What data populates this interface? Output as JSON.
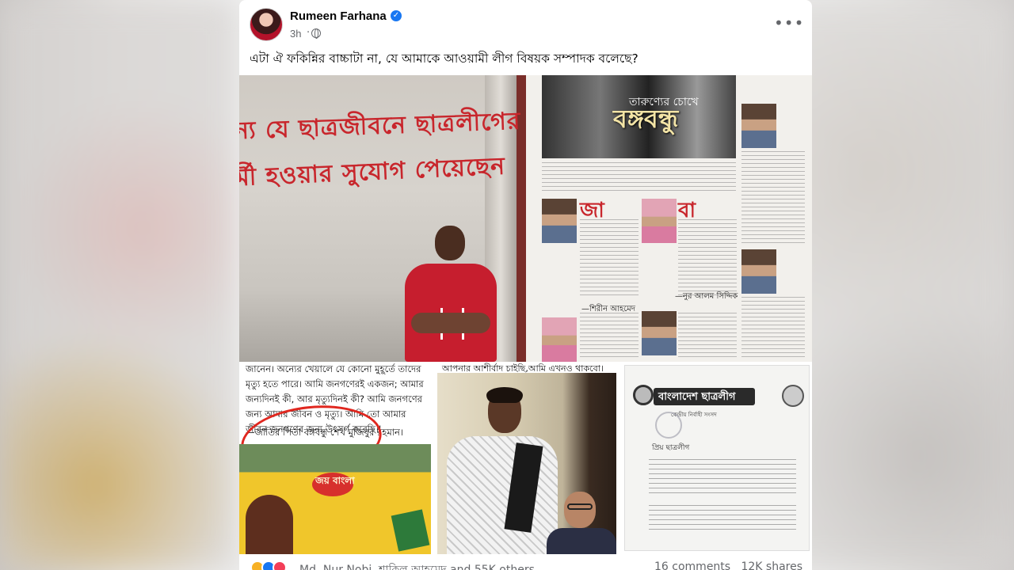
{
  "post": {
    "author": "Rumeen Farhana",
    "time": "3h",
    "separator": "·",
    "more_label": "•••",
    "verified_mark": "✓",
    "text": "এটা ঐ ফকিন্নির বাচ্চাটা না, যে আমাকে আওয়ামী লীগ বিষয়ক সম্পাদক বলেছে?"
  },
  "images": {
    "wall": {
      "line1": "ন্য যে ছাত্রজীবনে ছাত্রলীগের",
      "line2": "র্মী হওয়ার সুযোগ পেয়েছেন"
    },
    "newspaper": {
      "subtitle": "তারুণ্যের চোখে",
      "title": "বঙ্গবন্ধু",
      "byline1": "—শিরীন আহমেদ",
      "byline2": "—নুর আলম সিদ্দিক"
    },
    "quote": {
      "text": "জানেন। অন্যের খেয়ালে যে কোনো মুহূর্তে তাদের মৃত্যু হতে পারে। আমি জনগণেরই একজন; আমার জন্যদিনই কী, আর মৃত্যুদিনই কী? আমি জনগণের জন্য আমার জীবন ও মৃত্যু। আমি তো আমার জীবন জনগণের জন্য উৎসর্গ করেছি।'",
      "attribution": "—জাতির পিতা বঙ্গবন্ধু শেখ মুজিবুর রহমান।",
      "poster_text": "জয় বাংলা"
    },
    "portrait": {
      "caption": "আপনার আশীর্বাদ চাইছি,আমি এখনও থাকবো।"
    },
    "letter": {
      "header": "বাংলাদেশ ছাত্রলীগ",
      "sub": "কেন্দ্রীয় নির্বাহী সংসদ",
      "salutation": "প্রিয় ছাত্রলীগ"
    }
  },
  "engagement": {
    "reactors": "Md. Nur Nobi, শাকিল আহমেদ and 55K others",
    "comments": "16 comments",
    "shares": "12K shares"
  },
  "colors": {
    "accent": "#1877f2",
    "wall_text": "#c8262c"
  }
}
